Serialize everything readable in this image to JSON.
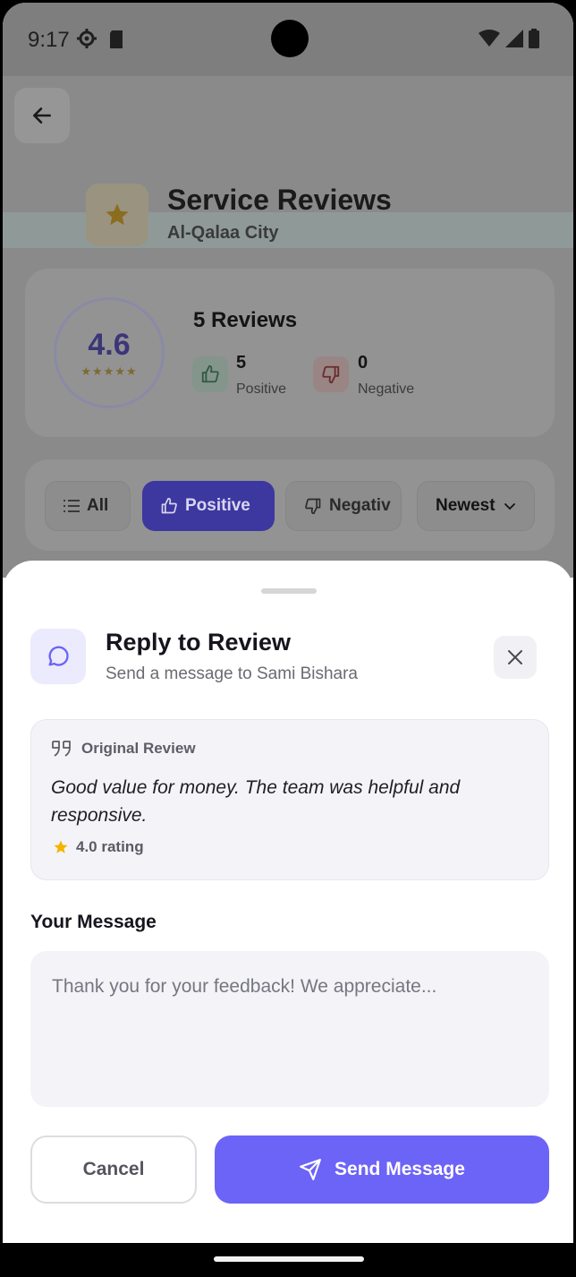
{
  "status_bar": {
    "time": "9:17"
  },
  "background": {
    "title": "Service Reviews",
    "subtitle": "Al-Qalaa City",
    "rating_value": "4.6",
    "rating_stars": "★★★★★",
    "rating_score": 4.6,
    "reviews_count": "5 Reviews",
    "positive_count": "5",
    "positive_label": "Positive",
    "negative_count": "0",
    "negative_label": "Negative",
    "filters": {
      "all": "All",
      "positive": "Positive",
      "negative": "Negativ",
      "sort": "Newest"
    }
  },
  "sheet": {
    "title": "Reply to Review",
    "subtitle": "Send a message to Sami Bishara",
    "original_review": {
      "label": "Original Review",
      "text": "Good value for money. The team was helpful and responsive.",
      "rating": "4.0 rating"
    },
    "message_label": "Your Message",
    "message_placeholder": "Thank you for your feedback! We appreciate...",
    "cancel_label": "Cancel",
    "send_label": "Send Message"
  },
  "colors": {
    "accent": "#6c63f7",
    "selected_chip_dim": "#3d37a0",
    "star": "#f5b400"
  }
}
